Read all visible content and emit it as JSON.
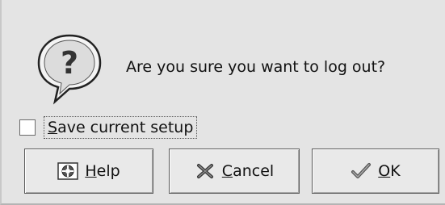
{
  "dialog": {
    "message": "Are you sure you want to log out?",
    "checkbox": {
      "label_mnemonic": "S",
      "label_rest": "ave current setup",
      "checked": false
    },
    "buttons": {
      "help": {
        "mnemonic": "H",
        "rest": "elp",
        "icon": "help-icon"
      },
      "cancel": {
        "mnemonic": "C",
        "rest": "ancel",
        "icon": "x-icon"
      },
      "ok": {
        "mnemonic": "O",
        "rest": "K",
        "icon": "checkmark-icon"
      }
    },
    "icon": "question-icon"
  }
}
